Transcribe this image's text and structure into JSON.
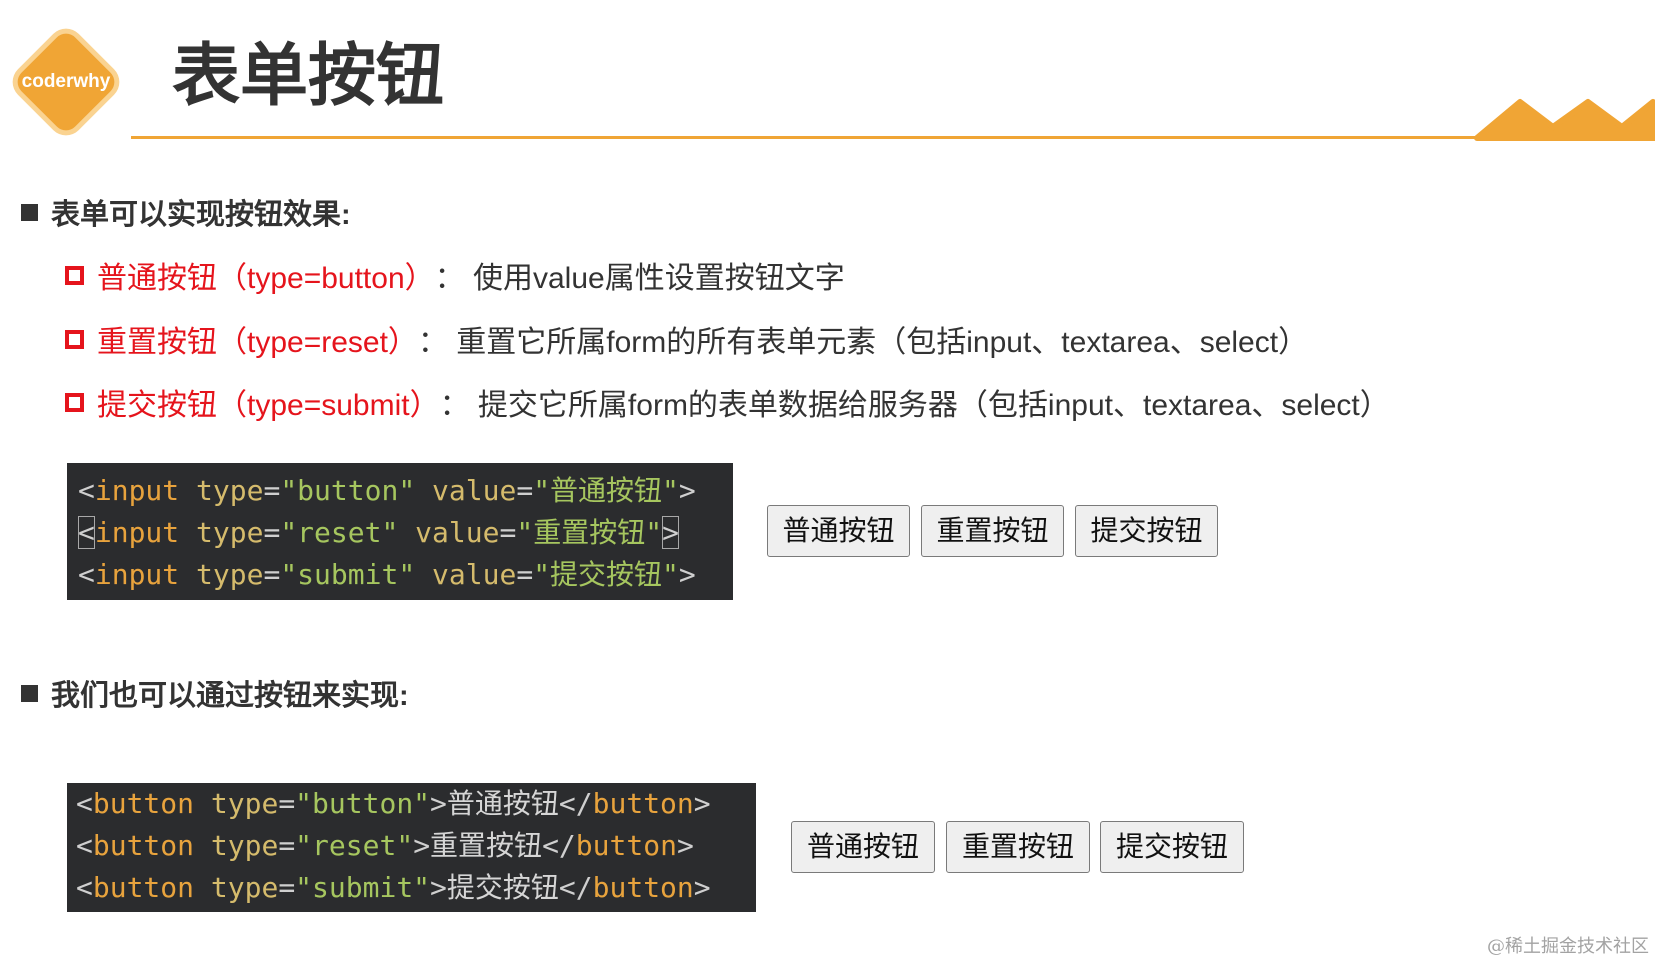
{
  "logo": {
    "text": "coderwhy"
  },
  "title": "表单按钮",
  "section1": {
    "heading": "表单可以实现按钮效果:",
    "items": [
      {
        "label": "普通按钮（type=button）",
        "desc": "： 使用value属性设置按钮文字"
      },
      {
        "label": "重置按钮（type=reset）",
        "desc": "： 重置它所属form的所有表单元素（包括input、textarea、select）"
      },
      {
        "label": "提交按钮（type=submit）",
        "desc": "： 提交它所属form的表单数据给服务器（包括input、textarea、select）"
      }
    ],
    "code": [
      [
        {
          "text": "<",
          "kind": "punct"
        },
        {
          "text": "input",
          "kind": "tag"
        },
        {
          "text": " type",
          "kind": "attr"
        },
        {
          "text": "=",
          "kind": "punct"
        },
        {
          "text": "\"button\"",
          "kind": "string"
        },
        {
          "text": " value",
          "kind": "attr"
        },
        {
          "text": "=",
          "kind": "punct"
        },
        {
          "text": "\"普通按钮\"",
          "kind": "string"
        },
        {
          "text": ">",
          "kind": "punct"
        }
      ],
      [
        {
          "text": "<",
          "kind": "punct",
          "boxed": true
        },
        {
          "text": "input",
          "kind": "tag"
        },
        {
          "text": " type",
          "kind": "attr"
        },
        {
          "text": "=",
          "kind": "punct"
        },
        {
          "text": "\"reset\"",
          "kind": "string"
        },
        {
          "text": " value",
          "kind": "attr"
        },
        {
          "text": "=",
          "kind": "punct"
        },
        {
          "text": "\"重置按钮\"",
          "kind": "string"
        },
        {
          "text": ">",
          "kind": "punct",
          "boxed": true
        }
      ],
      [
        {
          "text": "<",
          "kind": "punct"
        },
        {
          "text": "input",
          "kind": "tag"
        },
        {
          "text": " type",
          "kind": "attr"
        },
        {
          "text": "=",
          "kind": "punct"
        },
        {
          "text": "\"submit\"",
          "kind": "string"
        },
        {
          "text": " value",
          "kind": "attr"
        },
        {
          "text": "=",
          "kind": "punct"
        },
        {
          "text": "\"提交按钮\"",
          "kind": "string"
        },
        {
          "text": ">",
          "kind": "punct"
        }
      ]
    ],
    "buttons": [
      "普通按钮",
      "重置按钮",
      "提交按钮"
    ]
  },
  "section2": {
    "heading": "我们也可以通过按钮来实现:",
    "code": [
      [
        {
          "text": "<",
          "kind": "punct"
        },
        {
          "text": "button",
          "kind": "tag"
        },
        {
          "text": " type",
          "kind": "attr"
        },
        {
          "text": "=",
          "kind": "punct"
        },
        {
          "text": "\"button\"",
          "kind": "string"
        },
        {
          "text": ">",
          "kind": "punct"
        },
        {
          "text": "普通按钮",
          "kind": "text"
        },
        {
          "text": "</",
          "kind": "punct"
        },
        {
          "text": "button",
          "kind": "tag"
        },
        {
          "text": ">",
          "kind": "punct"
        }
      ],
      [
        {
          "text": "<",
          "kind": "punct"
        },
        {
          "text": "button",
          "kind": "tag"
        },
        {
          "text": " type",
          "kind": "attr"
        },
        {
          "text": "=",
          "kind": "punct"
        },
        {
          "text": "\"reset\"",
          "kind": "string"
        },
        {
          "text": ">",
          "kind": "punct"
        },
        {
          "text": "重置按钮",
          "kind": "text"
        },
        {
          "text": "</",
          "kind": "punct"
        },
        {
          "text": "button",
          "kind": "tag"
        },
        {
          "text": ">",
          "kind": "punct"
        }
      ],
      [
        {
          "text": "<",
          "kind": "punct"
        },
        {
          "text": "button",
          "kind": "tag"
        },
        {
          "text": " type",
          "kind": "attr"
        },
        {
          "text": "=",
          "kind": "punct"
        },
        {
          "text": "\"submit\"",
          "kind": "string"
        },
        {
          "text": ">",
          "kind": "punct"
        },
        {
          "text": "提交按钮",
          "kind": "text"
        },
        {
          "text": "</",
          "kind": "punct"
        },
        {
          "text": "button",
          "kind": "tag"
        },
        {
          "text": ">",
          "kind": "punct"
        }
      ]
    ],
    "buttons": [
      "普通按钮",
      "重置按钮",
      "提交按钮"
    ]
  },
  "watermark": "@稀土掘金技术社区",
  "colors": {
    "accent": "#f0a535",
    "item_red": "#e5141c",
    "text_dark": "#333333",
    "code_bg": "#2b2c2e",
    "tag": "#e8a33d",
    "attr": "#d5bb6c",
    "string": "#a6c65f",
    "punct": "#cfcfcf",
    "code_text": "#d6d6d6"
  }
}
